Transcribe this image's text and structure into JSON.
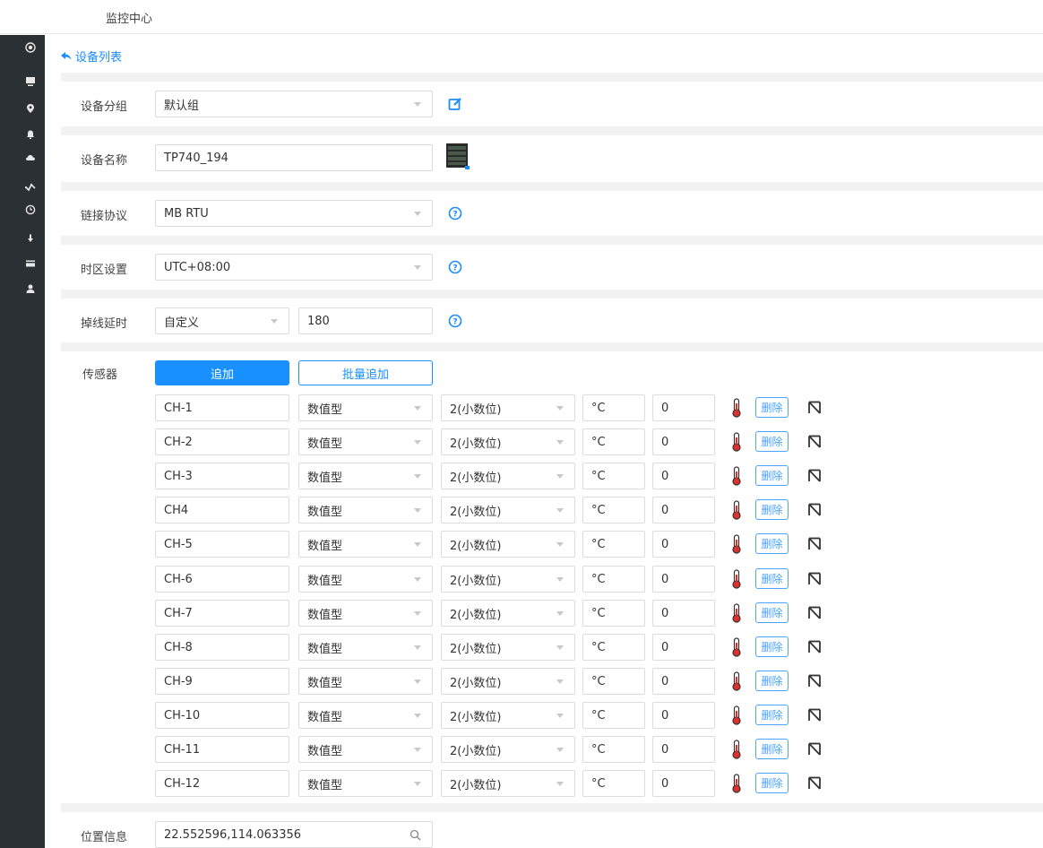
{
  "header": {
    "title": "监控中心"
  },
  "sidebar": {
    "items": [
      {
        "icon": "target-icon"
      },
      {
        "icon": "monitor-icon"
      },
      {
        "icon": "location-pin-icon"
      },
      {
        "icon": "bell-icon"
      },
      {
        "icon": "cloud-icon"
      },
      {
        "icon": "trend-icon"
      },
      {
        "icon": "clock-icon"
      },
      {
        "icon": "download-icon"
      },
      {
        "icon": "card-icon"
      },
      {
        "icon": "user-icon"
      }
    ]
  },
  "back_link": {
    "label": "设备列表"
  },
  "form": {
    "group": {
      "label": "设备分组",
      "value": "默认组"
    },
    "name": {
      "label": "设备名称",
      "value": "TP740_194"
    },
    "protocol": {
      "label": "链接协议",
      "value": "MB RTU"
    },
    "timezone": {
      "label": "时区设置",
      "value": "UTC+08:00"
    },
    "offline": {
      "label": "掉线延时",
      "mode": "自定义",
      "value": "180"
    },
    "sensors": {
      "label": "传感器",
      "add_label": "追加",
      "batch_add_label": "批量追加",
      "delete_label": "删除",
      "rows": [
        {
          "name": "CH-1",
          "type": "数值型",
          "decimals": "2(小数位)",
          "unit": "°C",
          "offset": "0"
        },
        {
          "name": "CH-2",
          "type": "数值型",
          "decimals": "2(小数位)",
          "unit": "°C",
          "offset": "0"
        },
        {
          "name": "CH-3",
          "type": "数值型",
          "decimals": "2(小数位)",
          "unit": "°C",
          "offset": "0"
        },
        {
          "name": "CH4",
          "type": "数值型",
          "decimals": "2(小数位)",
          "unit": "°C",
          "offset": "0"
        },
        {
          "name": "CH-5",
          "type": "数值型",
          "decimals": "2(小数位)",
          "unit": "°C",
          "offset": "0"
        },
        {
          "name": "CH-6",
          "type": "数值型",
          "decimals": "2(小数位)",
          "unit": "°C",
          "offset": "0"
        },
        {
          "name": "CH-7",
          "type": "数值型",
          "decimals": "2(小数位)",
          "unit": "°C",
          "offset": "0"
        },
        {
          "name": "CH-8",
          "type": "数值型",
          "decimals": "2(小数位)",
          "unit": "°C",
          "offset": "0"
        },
        {
          "name": "CH-9",
          "type": "数值型",
          "decimals": "2(小数位)",
          "unit": "°C",
          "offset": "0"
        },
        {
          "name": "CH-10",
          "type": "数值型",
          "decimals": "2(小数位)",
          "unit": "°C",
          "offset": "0"
        },
        {
          "name": "CH-11",
          "type": "数值型",
          "decimals": "2(小数位)",
          "unit": "°C",
          "offset": "0"
        },
        {
          "name": "CH-12",
          "type": "数值型",
          "decimals": "2(小数位)",
          "unit": "°C",
          "offset": "0"
        }
      ]
    },
    "location": {
      "label": "位置信息",
      "value": "22.552596,114.063356"
    }
  },
  "colors": {
    "accent": "#1890ff",
    "sidebar": "#2b3034",
    "thermometer": "#e0302d"
  }
}
